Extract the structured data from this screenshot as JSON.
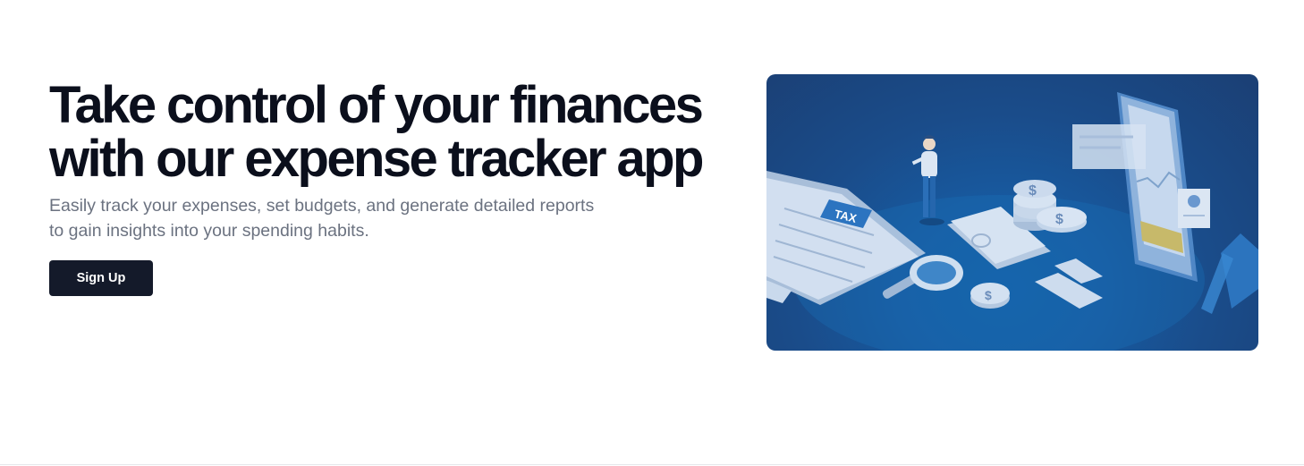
{
  "hero": {
    "title": "Take control of your finances with our expense tracker app",
    "subtitle": "Easily track your expenses, set budgets, and generate detailed reports to gain insights into your spending habits.",
    "cta_label": "Sign Up"
  },
  "illustration": {
    "tax_label": "TAX",
    "currency_symbol": "$",
    "colors": {
      "background_dark": "#1b3f74",
      "background_light": "#1360a7",
      "paper": "#c9d9ec",
      "accent_yellow": "#c7b96a"
    }
  }
}
